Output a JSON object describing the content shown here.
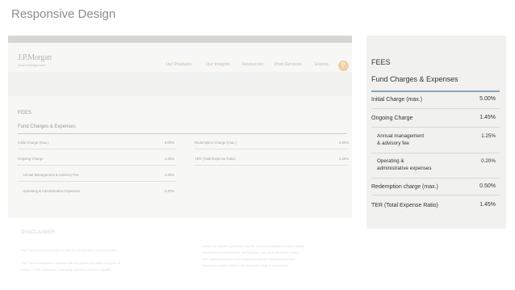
{
  "slide_title": "Responsive Design",
  "desktop": {
    "top_links": [
      "",
      "",
      "",
      ""
    ],
    "logo": {
      "name": "J.P.Morgan",
      "sub": "Asset Management"
    },
    "nav": [
      "Our Products",
      "Our Insights",
      "Resources",
      "Post Services",
      "Events"
    ],
    "search_icon": "search-icon",
    "fees_title": "FEES",
    "section_title": "Fund Charges & Expenses",
    "left_rows": [
      {
        "label": "Initial Charge (max.)",
        "value": "5.00%"
      },
      {
        "label": "Ongoing Charge",
        "value": "1.45%"
      },
      {
        "label": "Annual Management & Advisory Fee",
        "value": "1.25%"
      },
      {
        "label": "Operating & Administrative Expenses",
        "value": "0.20%"
      }
    ],
    "right_rows": [
      {
        "label": "Redemption Charge (max.)",
        "value": "0.50%"
      },
      {
        "label": "TER (Total Expense Ratio)",
        "value": "1.45%"
      }
    ],
    "disclaimer_title": "DISCLAIMER",
    "disclaimer_left": [
      "The Fund invests primarily in Asian bonds and other debt securities.",
      "The Fund is exposed to interest rate risk which may affect the price of",
      "bonds. Credit, settlement, emerging markets, currency, liquidity ..."
    ],
    "disclaimer_right": [
      "Where the dividend generated by the Fund is insufficient to pay a distrib-",
      "ution as the Fund declares, the Manager may at its discretion make",
      "such distributions out of the capital so that the distributed amount",
      "represents capital which is the Investor's original investment ..."
    ]
  },
  "mobile": {
    "fees_title": "FEES",
    "section_title": "Fund Charges & Expenses",
    "rows": [
      {
        "label": "Initial Charge (max.)",
        "value": "5.00%"
      },
      {
        "label": "Ongoing Charge",
        "value": "1.45%"
      },
      {
        "label": "Annual management\n& advisory fee",
        "value": "1.25%"
      },
      {
        "label": "Operating &\nadministrative expenses",
        "value": "0.20%"
      },
      {
        "label": "Redemption charge (max.)",
        "value": "0.50%"
      },
      {
        "label": "TER (Total Expense Ratio)",
        "value": "1.45%"
      }
    ]
  }
}
